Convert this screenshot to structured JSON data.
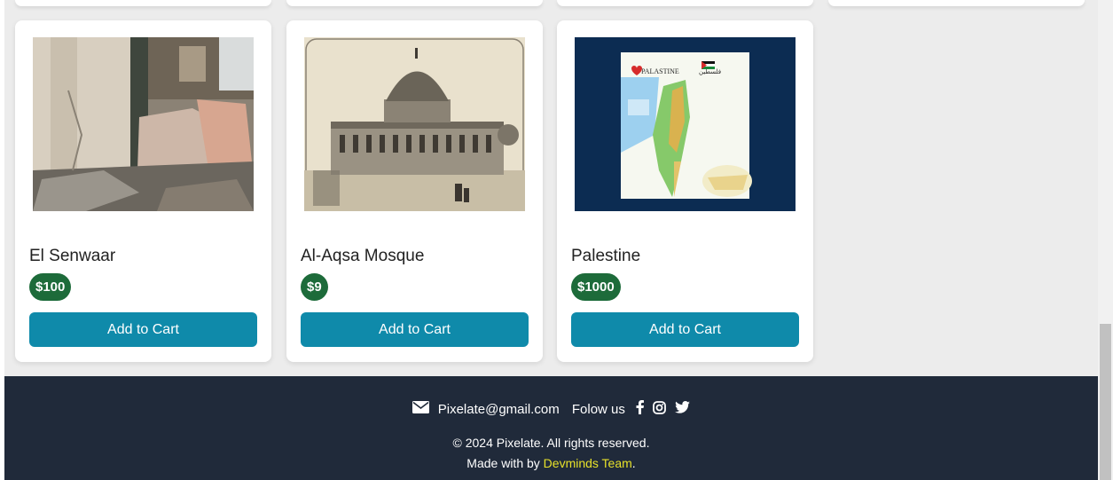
{
  "products": [
    {
      "title": "El Senwaar",
      "price": "$100",
      "button": "Add to Cart"
    },
    {
      "title": "Al-Aqsa Mosque",
      "price": "$9",
      "button": "Add to Cart"
    },
    {
      "title": "Palestine",
      "price": "$1000",
      "button": "Add to Cart"
    }
  ],
  "map_image": {
    "heading": "PALASTINE",
    "arabic": "فلسطين"
  },
  "footer": {
    "email": "Pixelate@gmail.com",
    "follow": "Folow us",
    "copyright": "© 2024 Pixelate. All rights reserved.",
    "made_prefix": "Made with by ",
    "team": "Devminds Team",
    "made_suffix": "."
  },
  "colors": {
    "button": "#0f8aaa",
    "price_badge": "#1d6b3a",
    "footer_bg": "#202a3a",
    "accent": "#e7e12a"
  },
  "icons": {
    "email": "envelope-icon",
    "facebook": "facebook-icon",
    "instagram": "instagram-icon",
    "twitter": "twitter-icon"
  }
}
